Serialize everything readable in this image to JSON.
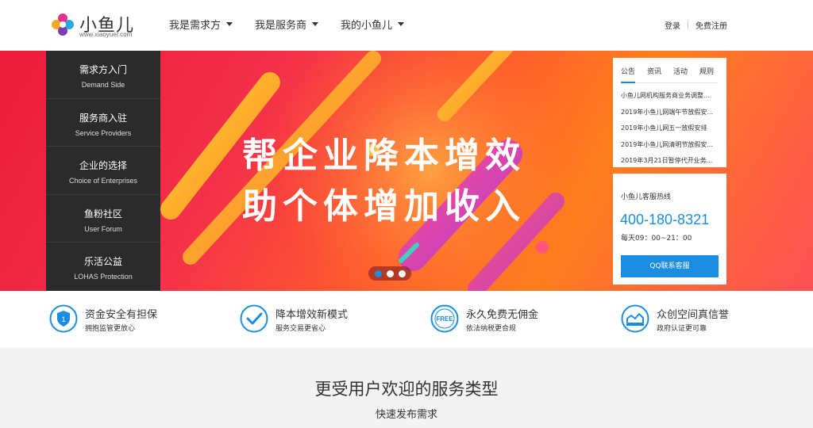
{
  "header": {
    "logo_name": "小鱼儿",
    "logo_url": "www.xiaoyuer.com",
    "nav": [
      "我是需求方",
      "我是服务商",
      "我的小鱼儿"
    ],
    "login": "登录",
    "register": "免费注册"
  },
  "side_menu": [
    {
      "cn": "需求方入门",
      "en": "Demand Side"
    },
    {
      "cn": "服务商入驻",
      "en": "Service Providers"
    },
    {
      "cn": "企业的选择",
      "en": "Choice of Enterprises"
    },
    {
      "cn": "鱼粉社区",
      "en": "User Forum"
    },
    {
      "cn": "乐活公益",
      "en": "LOHAS Protection"
    }
  ],
  "banner": {
    "line1": "帮企业降本增效",
    "line2": "助个体增加收入",
    "slides": 3,
    "active_slide": 1
  },
  "notice": {
    "tabs": [
      "公告",
      "资讯",
      "活动",
      "规则"
    ],
    "active_tab": 0,
    "items": [
      "小鱼儿网机构服务商业务调整...",
      "2019年小鱼儿网端午节放假安...",
      "2019年小鱼儿网五一放假安排",
      "2019年小鱼儿网清明节放假安...",
      "2019年3月21日暂停代开业务..."
    ]
  },
  "hotline": {
    "title": "小鱼儿客服热线",
    "phone": "400-180-8321",
    "hours": "每天09：00~21：00",
    "qq_button": "QQ联系客服"
  },
  "features": [
    {
      "title": "资金安全有担保",
      "sub": "拥抱监管更放心",
      "icon": "shield-icon"
    },
    {
      "title": "降本增效新模式",
      "sub": "服务交易更省心",
      "icon": "check-icon"
    },
    {
      "title": "永久免费无佣金",
      "sub": "依法纳税更合规",
      "icon": "free-icon"
    },
    {
      "title": "众创空间真信誉",
      "sub": "政府认证更可靠",
      "icon": "building-icon"
    }
  ],
  "section": {
    "title": "更受用户欢迎的服务类型",
    "subtitle": "快速发布需求"
  },
  "colors": {
    "accent": "#1a8de0",
    "sidebar": "#2b2b2b",
    "banner_red": "#ec1b3a",
    "banner_orange": "#ff7e1c"
  }
}
